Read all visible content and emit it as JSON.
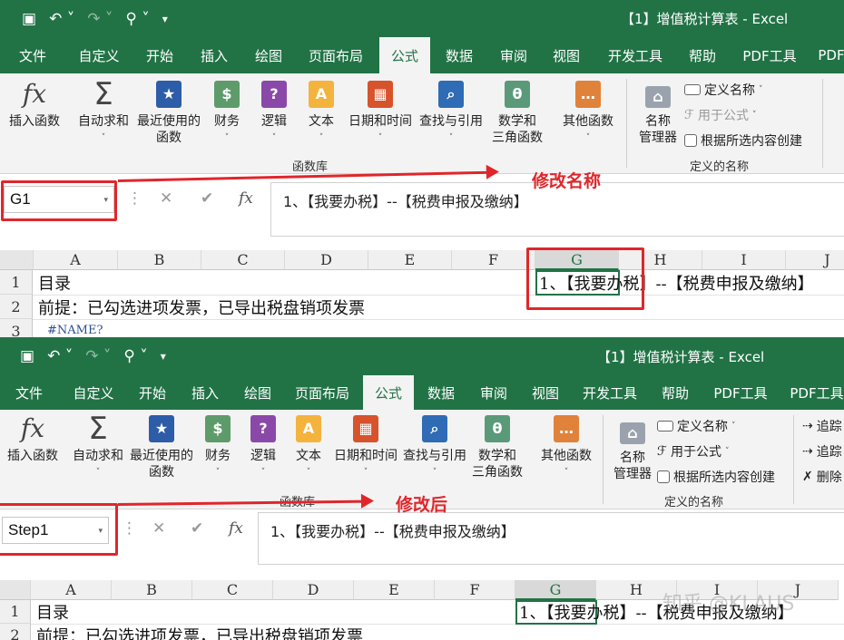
{
  "top": {
    "window_title": "【1】增值税计算表 - Excel",
    "quick_access": [
      "save-icon",
      "undo-icon",
      "redo-icon",
      "touch-mode-icon",
      "customize-icon"
    ],
    "tabs": [
      "文件",
      "自定义",
      "开始",
      "插入",
      "绘图",
      "页面布局",
      "公式",
      "数据",
      "审阅",
      "视图",
      "开发工具",
      "帮助",
      "PDF工具",
      "PDF"
    ],
    "ribbon": {
      "buttons": [
        "插入函数",
        "自动求和",
        "最近使用的\n函数",
        "财务",
        "逻辑",
        "文本",
        "日期和时间",
        "查找与引用",
        "数学和\n三角函数",
        "其他函数"
      ],
      "name_manager": "名称\n管理器",
      "define_name": "定义名称",
      "use_in_formula": "用于公式",
      "create_from_selection": "根据所选内容创建",
      "group_library": "函数库",
      "group_names": "定义的名称"
    },
    "name_box": "G1",
    "formula": "1、【我要办税】--【税费申报及缴纳】",
    "annotation": "修改名称",
    "columns": [
      "A",
      "B",
      "C",
      "D",
      "E",
      "F",
      "G",
      "H",
      "I",
      "J"
    ],
    "rows": [
      "1",
      "2",
      "3"
    ],
    "cells": {
      "A1": "目录",
      "A2": "前提：已勾选进项发票，已导出税盘销项发票",
      "A3": "#NAME?",
      "G1": "1、【我要办税】--【税费申报及缴纳】"
    }
  },
  "bottom": {
    "window_title": "【1】增值税计算表 - Excel",
    "tabs": [
      "文件",
      "自定义",
      "开始",
      "插入",
      "绘图",
      "页面布局",
      "公式",
      "数据",
      "审阅",
      "视图",
      "开发工具",
      "帮助",
      "PDF工具",
      "PDF工具"
    ],
    "ribbon": {
      "buttons": [
        "插入函数",
        "自动求和",
        "最近使用的\n函数",
        "财务",
        "逻辑",
        "文本",
        "日期和时间",
        "查找与引用",
        "数学和\n三角函数",
        "其他函数"
      ],
      "name_manager": "名称\n管理器",
      "define_name": "定义名称",
      "use_in_formula": "用于公式",
      "create_from_selection": "根据所选内容创建",
      "trace_precedents": "追踪",
      "trace_dependents": "追踪",
      "remove_arrows": "删除",
      "group_library": "函数库",
      "group_names": "定义的名称"
    },
    "name_box": "Step1",
    "formula": "1、【我要办税】--【税费申报及缴纳】",
    "annotation": "修改后",
    "columns": [
      "A",
      "B",
      "C",
      "D",
      "E",
      "F",
      "G",
      "H",
      "I",
      "J"
    ],
    "rows": [
      "1",
      "2"
    ],
    "cells": {
      "A1": "目录",
      "A2": "前提：已勾选进项发票，已导出税盘销项发票",
      "G1": "1、【我要办税】--【税费申报及缴纳】"
    },
    "watermark": "知乎 @KLAUS"
  },
  "colors": {
    "excel_green": "#217346",
    "annotation_red": "#e0262b"
  }
}
